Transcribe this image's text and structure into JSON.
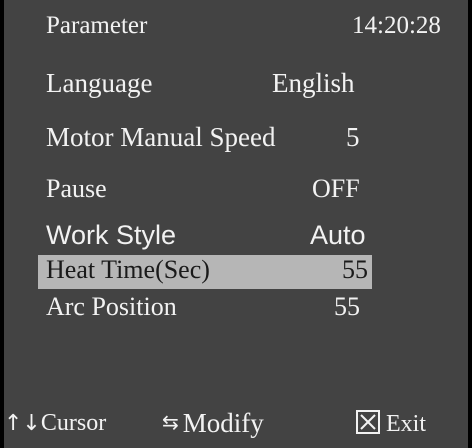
{
  "header": {
    "title": "Parameter",
    "time": "14:20:28"
  },
  "params": [
    {
      "label": "Language",
      "value": "English"
    },
    {
      "label": "Motor Manual Speed",
      "value": "5"
    },
    {
      "label": "Pause",
      "value": "OFF"
    },
    {
      "label": "Work Style",
      "value": "Auto"
    },
    {
      "label": "Heat Time(Sec)",
      "value": "55"
    },
    {
      "label": "Arc Position",
      "value": "55"
    }
  ],
  "footer": {
    "cursor_icon": "up-down-arrows-icon",
    "cursor_label": "Cursor",
    "modify_icon": "left-right-arrows-icon",
    "modify_label": "Modify",
    "exit_icon": "boxed-x-icon",
    "exit_label": "Exit"
  },
  "colors": {
    "background": "#434343",
    "text": "#f2f2f2",
    "highlight": "#b6b6b6"
  }
}
